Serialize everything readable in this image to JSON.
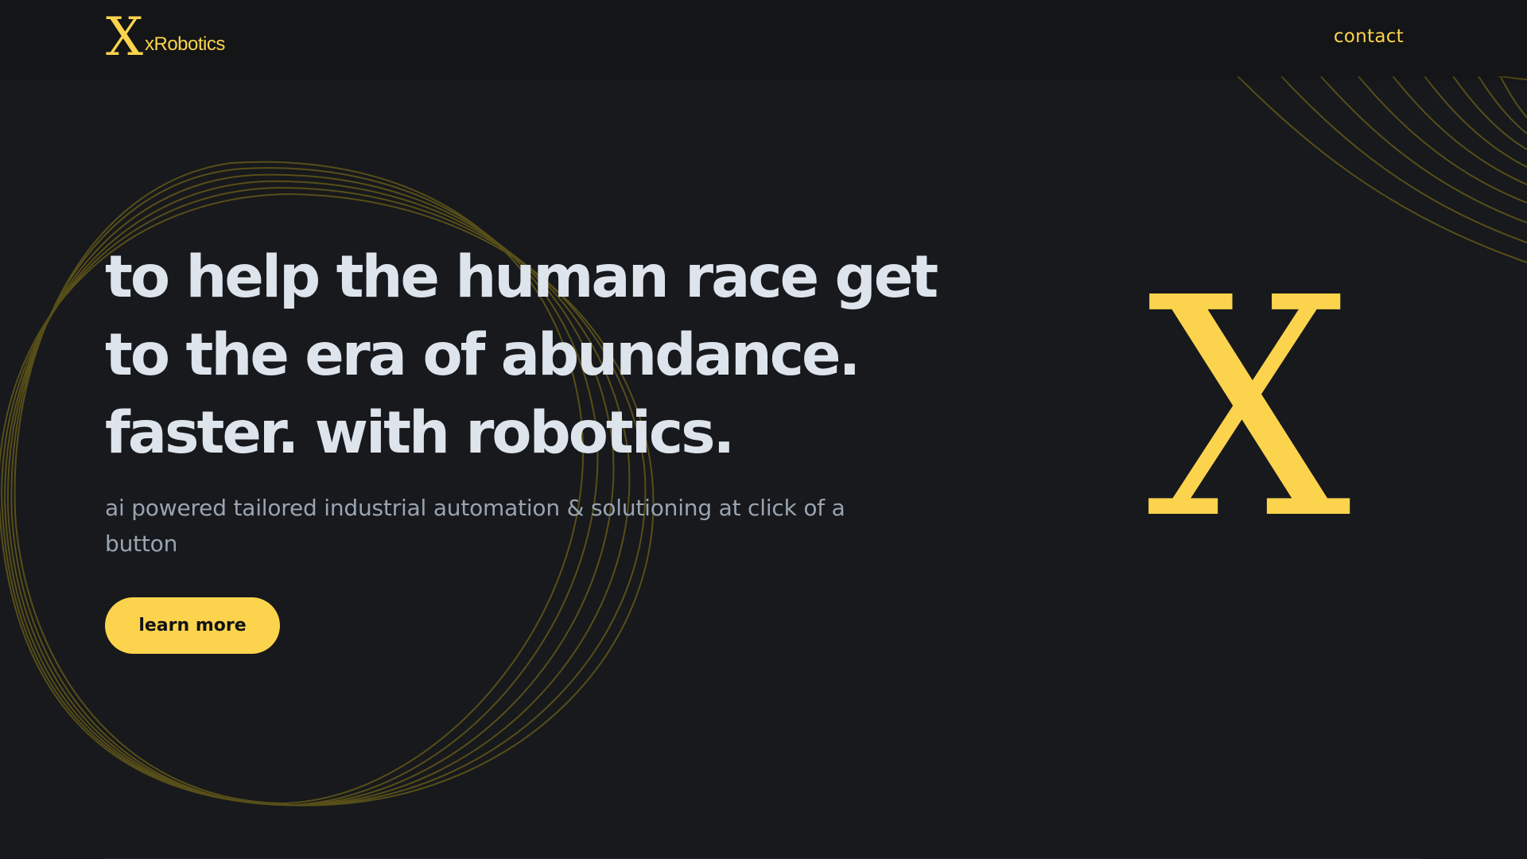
{
  "header": {
    "logo_mark": "X",
    "brand": "xRobotics",
    "contact_label": "contact"
  },
  "hero": {
    "title_lines": [
      "to help the human race get",
      "to the era of abundance.",
      "faster. with robotics."
    ],
    "subtitle": "ai powered tailored industrial automation & solutioning at click of a button",
    "cta_label": "learn more"
  },
  "hero_graphic": {
    "mark": "X"
  },
  "colors": {
    "background": "#17191c",
    "header_background": "#131517",
    "accent": "#fcd34d",
    "title_text": "#dde4ec",
    "subtitle_text": "#9aa4b1"
  },
  "icons": {
    "logo": "x-logo-icon",
    "decoration": "wave-lines-decoration"
  }
}
